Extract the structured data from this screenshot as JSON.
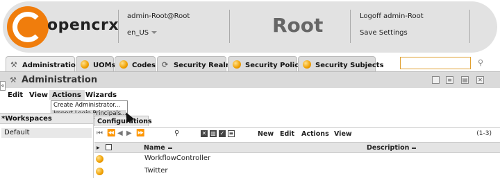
{
  "header": {
    "logo_text": "opencrx",
    "user": "admin-Root@Root",
    "locale": "en_US",
    "segment": "Root",
    "logoff": "Logoff admin-Root",
    "save_settings": "Save Settings"
  },
  "tabs": [
    {
      "label": "Administration",
      "icon": "wrench-icon",
      "active": true
    },
    {
      "label": "UOMs",
      "icon": "orb-icon"
    },
    {
      "label": "Codes",
      "icon": "orb-icon"
    },
    {
      "label": "Security Realm",
      "icon": "gear-icon"
    },
    {
      "label": "Security Policy",
      "icon": "orb-icon"
    },
    {
      "label": "Security Subjects",
      "icon": "orb-icon"
    }
  ],
  "search": {
    "value": "",
    "placeholder": ""
  },
  "title": "Administration",
  "menu": {
    "edit": "Edit",
    "view": "View",
    "actions": "Actions",
    "wizards": "Wizards"
  },
  "dropdown": {
    "items": [
      "Create Administrator...",
      "Import Login Principals..."
    ]
  },
  "workspaces": {
    "header": "*Workspaces",
    "items": [
      "Default"
    ]
  },
  "grid": {
    "tab_label": "Configurations",
    "toolbar": {
      "new": "New",
      "edit": "Edit",
      "actions": "Actions",
      "view": "View",
      "count": "(1-3)"
    },
    "columns": {
      "name": "Name",
      "description": "Description"
    },
    "rows": [
      {
        "name": "WorkflowController",
        "description": ""
      },
      {
        "name": "Twitter",
        "description": ""
      }
    ]
  },
  "colors": {
    "brand_orange": "#f07d0c",
    "header_bg": "#e2e2e2",
    "search_border": "#e0a030"
  }
}
